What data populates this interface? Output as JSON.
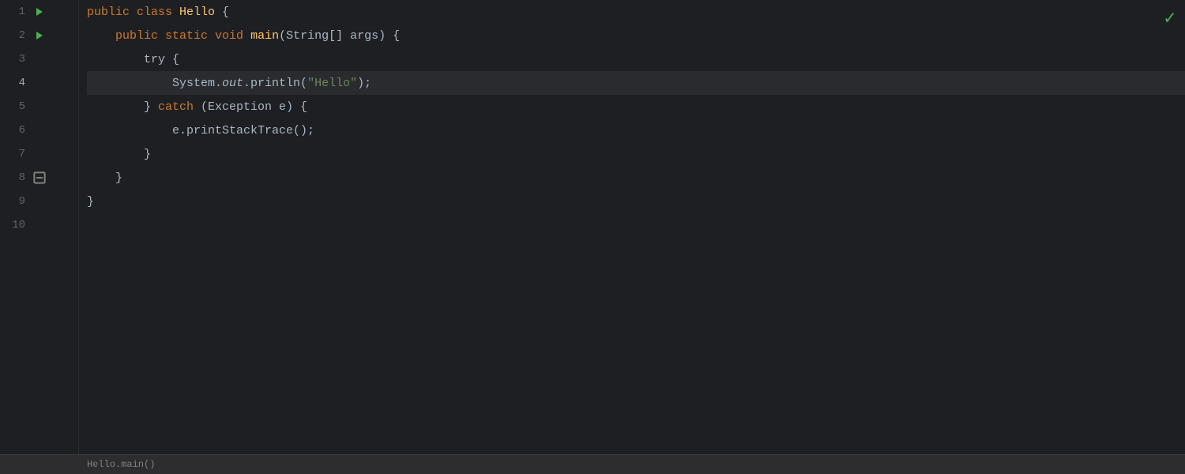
{
  "editor": {
    "background": "#1e1f22",
    "checkmark": "✓",
    "lines": [
      {
        "number": "1",
        "hasRunIcon": true,
        "hasFoldIcon": false,
        "isActive": false,
        "content": [
          {
            "text": "public ",
            "cls": "kw"
          },
          {
            "text": "class ",
            "cls": "kw"
          },
          {
            "text": "Hello",
            "cls": "class-name"
          },
          {
            "text": " {",
            "cls": "plain"
          }
        ]
      },
      {
        "number": "2",
        "hasRunIcon": true,
        "hasFoldIcon": true,
        "isActive": false,
        "content": [
          {
            "text": "    public ",
            "cls": "kw"
          },
          {
            "text": "static ",
            "cls": "kw"
          },
          {
            "text": "void ",
            "cls": "kw"
          },
          {
            "text": "main",
            "cls": "method"
          },
          {
            "text": "(",
            "cls": "plain"
          },
          {
            "text": "String",
            "cls": "plain"
          },
          {
            "text": "[] args) {",
            "cls": "plain"
          }
        ]
      },
      {
        "number": "3",
        "hasRunIcon": false,
        "hasFoldIcon": false,
        "isActive": false,
        "content": [
          {
            "text": "        try {",
            "cls": "plain"
          }
        ]
      },
      {
        "number": "4",
        "hasRunIcon": false,
        "hasFoldIcon": false,
        "isActive": true,
        "hasCursor": true,
        "content": [
          {
            "text": "            System.",
            "cls": "plain"
          },
          {
            "text": "out",
            "cls": "italic plain"
          },
          {
            "text": ".println(",
            "cls": "plain"
          },
          {
            "text": "\"Hello\"",
            "cls": "str"
          },
          {
            "text": ");",
            "cls": "plain"
          }
        ]
      },
      {
        "number": "5",
        "hasRunIcon": false,
        "hasFoldIcon": false,
        "isActive": false,
        "content": [
          {
            "text": "        } ",
            "cls": "plain"
          },
          {
            "text": "catch ",
            "cls": "kw"
          },
          {
            "text": "(Exception e) {",
            "cls": "plain"
          }
        ]
      },
      {
        "number": "6",
        "hasRunIcon": false,
        "hasFoldIcon": false,
        "isActive": false,
        "content": [
          {
            "text": "            e.printStackTrace();",
            "cls": "plain"
          }
        ]
      },
      {
        "number": "7",
        "hasRunIcon": false,
        "hasFoldIcon": false,
        "isActive": false,
        "content": [
          {
            "text": "        }",
            "cls": "plain"
          }
        ]
      },
      {
        "number": "8",
        "hasRunIcon": false,
        "hasFoldIcon": true,
        "isActive": false,
        "content": [
          {
            "text": "    }",
            "cls": "plain"
          }
        ]
      },
      {
        "number": "9",
        "hasRunIcon": false,
        "hasFoldIcon": false,
        "isActive": false,
        "content": [
          {
            "text": "}",
            "cls": "plain"
          }
        ]
      },
      {
        "number": "10",
        "hasRunIcon": false,
        "hasFoldIcon": false,
        "isActive": false,
        "content": []
      }
    ],
    "bottomBarText": "Hello.main()"
  }
}
